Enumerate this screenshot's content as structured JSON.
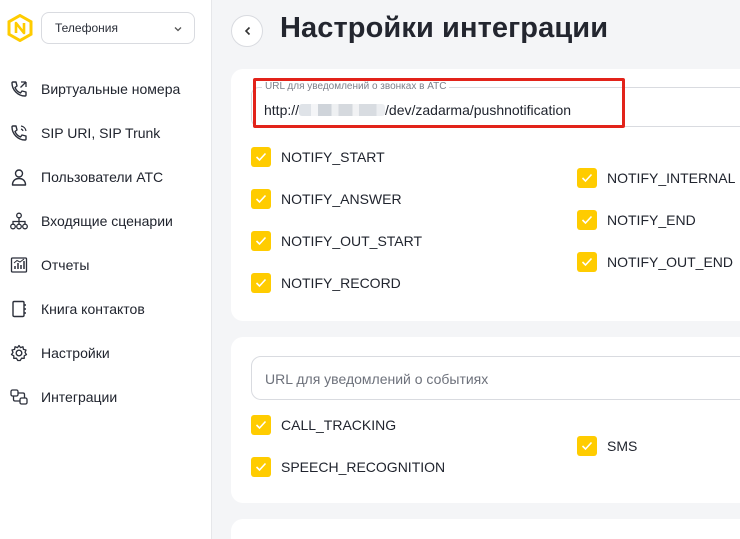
{
  "sidebar": {
    "selector": {
      "value": "Телефония"
    },
    "items": [
      {
        "label": "Виртуальные номера",
        "icon": "phone-forward-icon"
      },
      {
        "label": "SIP URI, SIP Trunk",
        "icon": "phone-icon"
      },
      {
        "label": "Пользователи АТС",
        "icon": "user-icon"
      },
      {
        "label": "Входящие сценарии",
        "icon": "hierarchy-icon"
      },
      {
        "label": "Отчеты",
        "icon": "chart-icon"
      },
      {
        "label": "Книга контактов",
        "icon": "contact-book-icon"
      },
      {
        "label": "Настройки",
        "icon": "gear-icon"
      },
      {
        "label": "Интеграции",
        "icon": "integration-icon"
      }
    ]
  },
  "header": {
    "title": "Настройки интеграции"
  },
  "pbx_section": {
    "url_label": "URL для уведомлений о звонках в АТС",
    "url_prefix": "http://",
    "url_suffix": "/dev/zadarma/pushnotification",
    "left_options": [
      "NOTIFY_START",
      "NOTIFY_ANSWER",
      "NOTIFY_OUT_START",
      "NOTIFY_RECORD"
    ],
    "right_options": [
      "NOTIFY_INTERNAL",
      "NOTIFY_END",
      "NOTIFY_OUT_END"
    ]
  },
  "events_section": {
    "url_placeholder": "URL для уведомлений о событиях",
    "left_options": [
      "CALL_TRACKING",
      "SPEECH_RECOGNITION"
    ],
    "right_options": [
      "SMS"
    ]
  },
  "colors": {
    "accent": "#ffcc00",
    "highlight": "#e2231a"
  }
}
